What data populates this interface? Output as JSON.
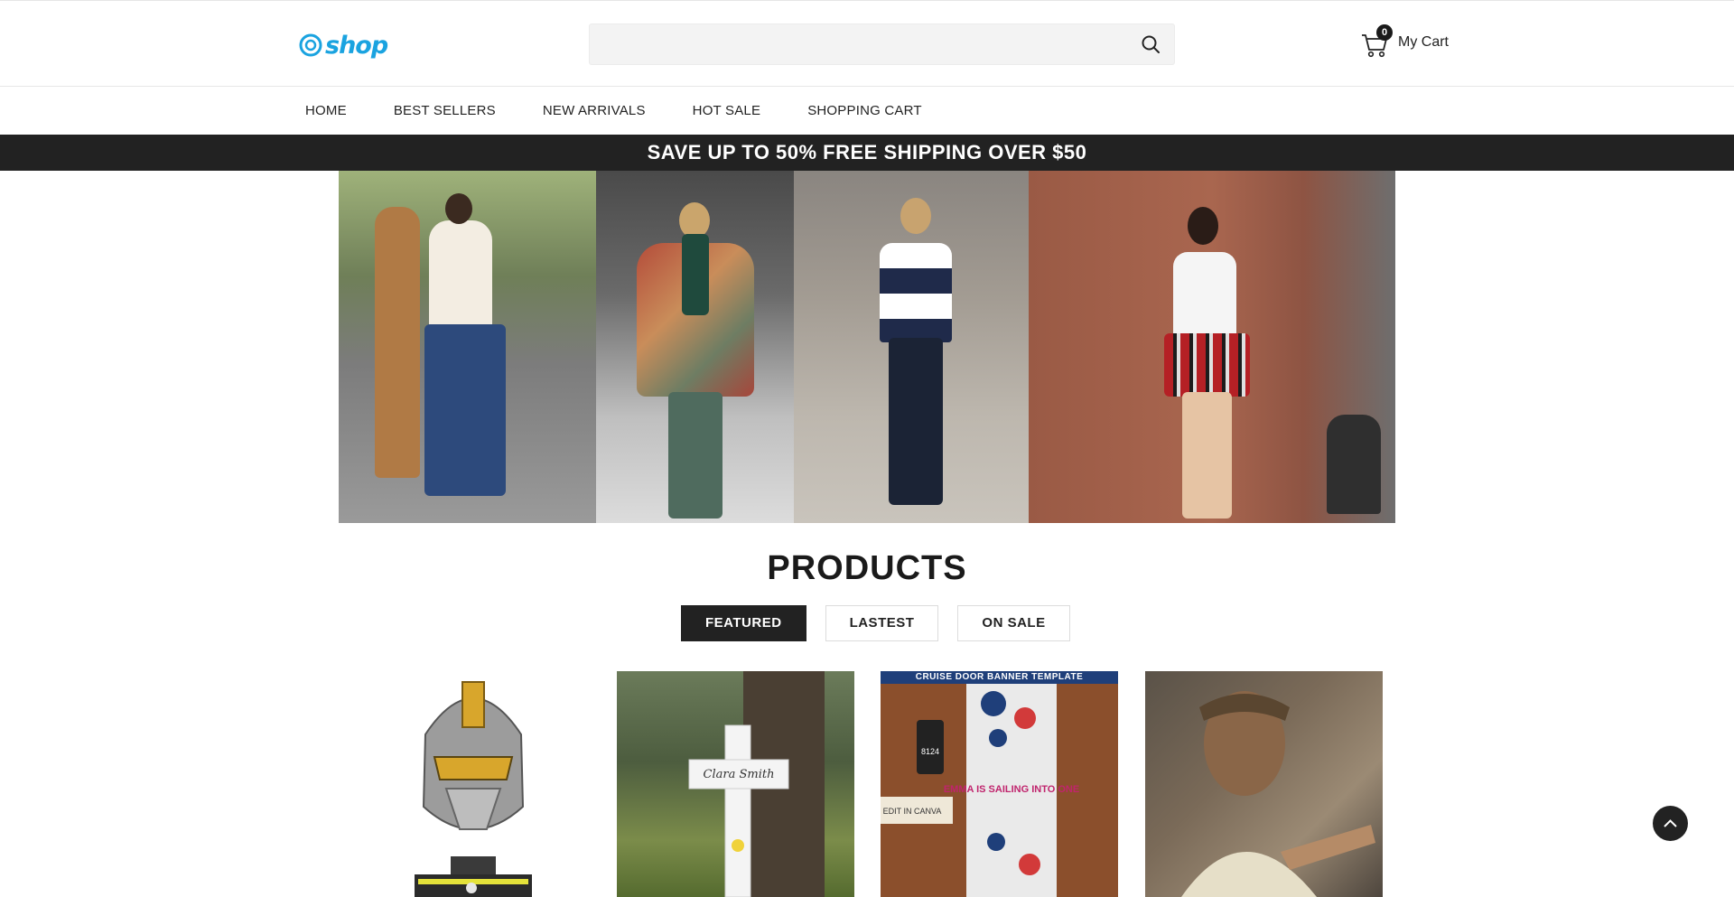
{
  "header": {
    "logo_text": "shop",
    "search": {
      "placeholder": "",
      "value": ""
    },
    "cart": {
      "count": "0",
      "label": "My Cart"
    }
  },
  "nav": {
    "items": [
      {
        "label": "HOME"
      },
      {
        "label": "BEST SELLERS"
      },
      {
        "label": "NEW ARRIVALS"
      },
      {
        "label": "HOT SALE"
      },
      {
        "label": "SHOPPING CART"
      }
    ]
  },
  "promo": {
    "text": "SAVE UP TO 50% FREE SHIPPING OVER $50"
  },
  "products_section": {
    "title": "PRODUCTS",
    "tabs": [
      {
        "label": "FEATURED",
        "active": true
      },
      {
        "label": "LASTEST",
        "active": false
      },
      {
        "label": "ON SALE",
        "active": false
      }
    ],
    "banner_template_text": "CRUISE DOOR BANNER TEMPLATE",
    "door_number": "8124",
    "door_sign": "EDIT IN CANVA",
    "banner_text": "EMMA IS SAILING INTO ONE",
    "memorial_name": "Clara Smith"
  },
  "colors": {
    "accent": "#1aa3e0",
    "dark": "#222222",
    "border": "#dcdcdc"
  },
  "icons": {
    "search": "search-icon",
    "cart": "cart-icon",
    "back_to_top": "chevron-up-icon"
  }
}
